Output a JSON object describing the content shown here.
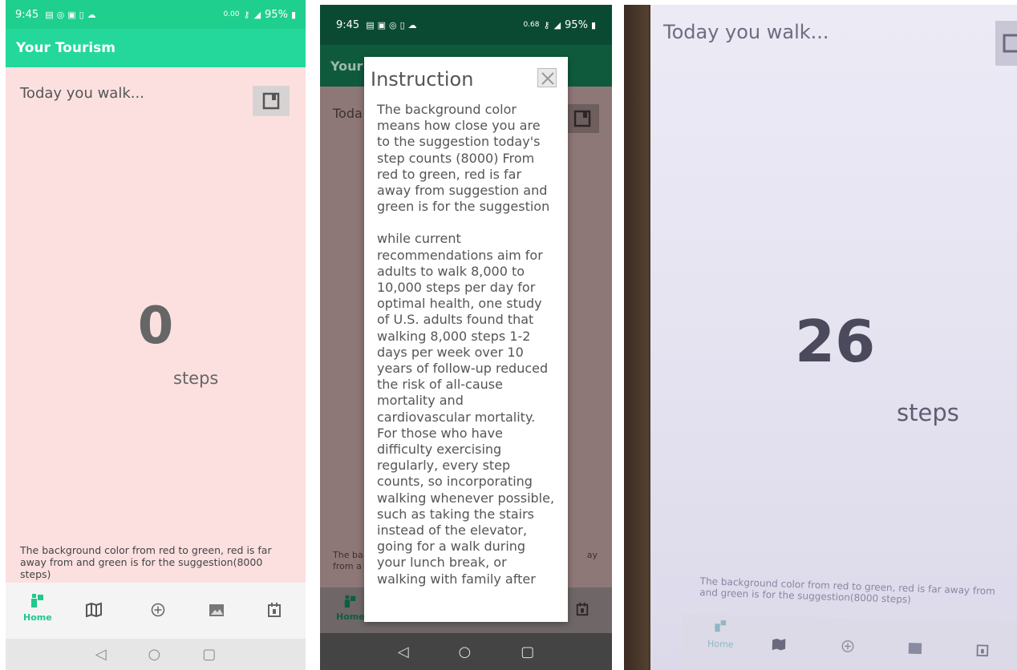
{
  "colors": {
    "accent": "#24d89b",
    "background_far": "#fce0e0",
    "background_close": "#eceaf5"
  },
  "status": {
    "time": "9:45",
    "net_speed_1": "0.00",
    "net_speed_2": "0.68",
    "net_unit": "KB/S",
    "battery": "95%"
  },
  "app": {
    "title": "Your Tourism",
    "title_partial": "Your"
  },
  "home": {
    "prompt": "Today you walk...",
    "prompt_partial": "Toda",
    "steps_panel1": "0",
    "steps_panel3": "26",
    "steps_unit": "steps",
    "note": "The background color from red to green, red is far away from and green is for the suggestion(8000 steps)",
    "note_partial_left": "The ba\nfrom a",
    "note_partial_right": "ay"
  },
  "nav": {
    "home_label": "Home",
    "items": [
      "home-icon",
      "map-icon",
      "add-icon",
      "gallery-icon",
      "calendar-icon"
    ]
  },
  "dialog": {
    "title": "Instruction",
    "para1": "The background color means how close you are to the suggestion today's step counts (8000) From red to green, red is far away from suggestion and green is for the suggestion",
    "para2": "while current recommendations aim for adults to walk 8,000 to 10,000 steps per day for optimal health, one study of U.S. adults found that walking 8,000 steps 1-2 days per week over 10 years of follow-up reduced the risk of all-cause mortality and cardiovascular mortality. For those who have difficulty exercising regularly, every step counts, so incorporating walking whenever possible, such as taking the stairs instead of the elevator, going for a walk during your lunch break, or walking with family after"
  }
}
